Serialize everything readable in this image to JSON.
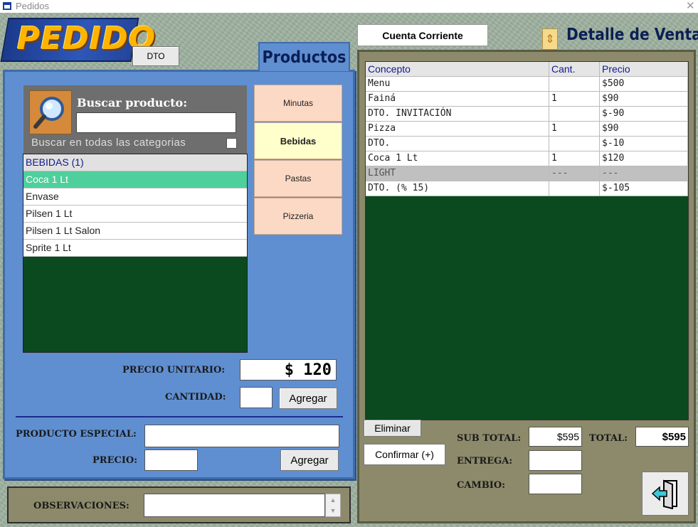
{
  "window": {
    "title": "Pedidos",
    "close_glyph": "✕"
  },
  "header": {
    "logo_text": "PEDIDO",
    "dto_label": "DTO",
    "productos_tab": "Productos"
  },
  "search": {
    "label": "Buscar producto:",
    "value": "",
    "all_categories_label": "Buscar en todas las categorias",
    "all_categories_checked": false
  },
  "products": {
    "header": "BEBIDAS (1)",
    "items": [
      "Coca 1 Lt",
      "Envase",
      "Pilsen 1 Lt",
      "Pilsen 1 Lt Salon",
      "Sprite 1 Lt"
    ],
    "selected": "Coca 1 Lt"
  },
  "categories": [
    {
      "label": "Minutas",
      "active": false
    },
    {
      "label": "Bebidas",
      "active": true
    },
    {
      "label": "Pastas",
      "active": false
    },
    {
      "label": "Pizzeria",
      "active": false
    }
  ],
  "order_form": {
    "unit_price_label": "PRECIO UNITARIO:",
    "unit_price_value": "$ 120",
    "quantity_label": "CANTIDAD:",
    "quantity_value": "",
    "add_label": "Agregar",
    "special_product_label": "PRODUCTO ESPECIAL:",
    "special_product_value": "",
    "price_label": "PRECIO:",
    "price_value": "",
    "add_special_label": "Agregar"
  },
  "observations": {
    "label": "OBSERVACIONES:",
    "value": ""
  },
  "right": {
    "cuenta_corriente_label": "Cuenta Corriente",
    "detalle_title": "Detalle de Venta",
    "columns": [
      "Concepto",
      "Cant.",
      "Precio"
    ],
    "rows": [
      {
        "concepto": "Menu",
        "cant": "",
        "precio": "$500",
        "style": "norm"
      },
      {
        "concepto": "Fainá",
        "cant": "1",
        "precio": "$90",
        "style": "norm"
      },
      {
        "concepto": "DTO. INVITACIÓN",
        "cant": "",
        "precio": "$-90",
        "style": "norm"
      },
      {
        "concepto": "Pizza",
        "cant": "1",
        "precio": "$90",
        "style": "norm"
      },
      {
        "concepto": "DTO.",
        "cant": "",
        "precio": "$-10",
        "style": "norm"
      },
      {
        "concepto": "Coca 1 Lt",
        "cant": "1",
        "precio": "$120",
        "style": "norm"
      },
      {
        "concepto": "LIGHT",
        "cant": "---",
        "precio": "---",
        "style": "alt"
      },
      {
        "concepto": "DTO. (% 15)",
        "cant": "",
        "precio": "$-105",
        "style": "norm"
      }
    ],
    "eliminar_label": "Eliminar",
    "confirmar_label": "Confirmar (+)",
    "subtotal_label": "SUB TOTAL:",
    "subtotal_value": "$595",
    "total_label": "TOTAL:",
    "total_value": "$595",
    "entrega_label": "ENTREGA:",
    "entrega_value": "",
    "cambio_label": "CAMBIO:",
    "cambio_value": ""
  },
  "colors": {
    "left_panel": "#5f8fd1",
    "right_panel": "#8c8a6a",
    "list_background": "#0a4a1e",
    "selected_row": "#4ecf9c",
    "category_button": "#fcd9c4",
    "active_category": "#ffffcc"
  }
}
